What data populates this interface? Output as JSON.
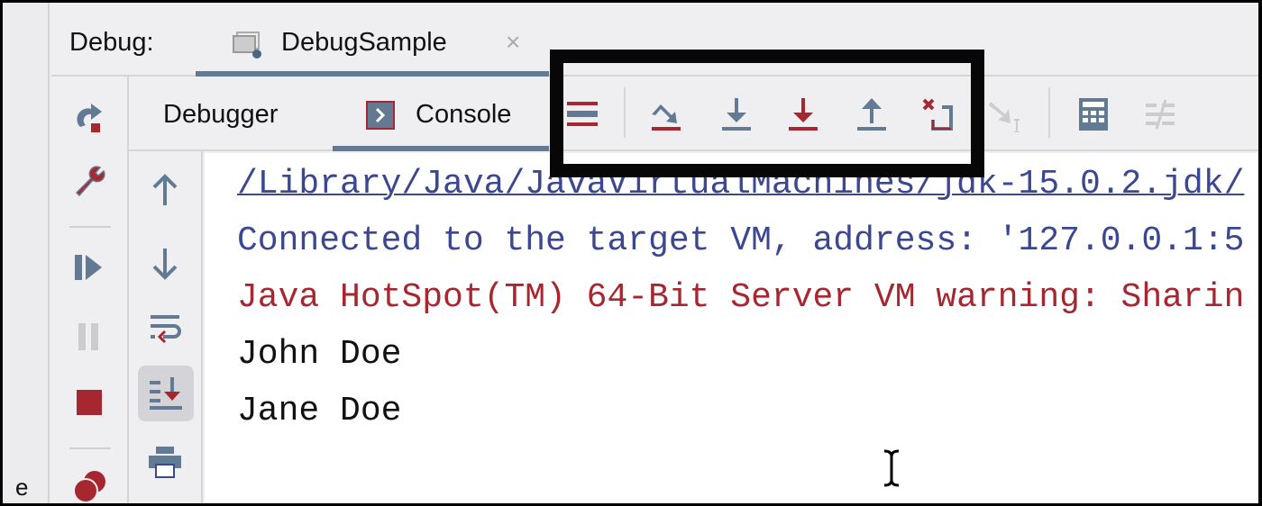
{
  "header": {
    "label": "Debug:",
    "tab_title": "DebugSample",
    "tab_close": "×"
  },
  "left_strip": {
    "fragment": "e"
  },
  "subtabs": {
    "debugger": "Debugger",
    "console": "Console"
  },
  "toolbar_icons": [
    "layout-menu-icon",
    "step-over-icon",
    "step-into-icon",
    "force-step-into-icon",
    "step-out-icon",
    "drop-frame-icon",
    "run-to-cursor-icon",
    "evaluate-expression-icon",
    "trace-icon"
  ],
  "console": {
    "lines": [
      {
        "text": "/Library/Java/JavaVirtualMachines/jdk-15.0.2.jdk/",
        "kind": "path"
      },
      {
        "text": "Connected to the target VM, address: '127.0.0.1:5",
        "kind": "info"
      },
      {
        "text": "Java HotSpot(TM) 64-Bit Server VM warning: Sharin",
        "kind": "warn"
      },
      {
        "text": "John Doe",
        "kind": "out"
      },
      {
        "text": "Jane Doe",
        "kind": "out"
      }
    ]
  },
  "colors": {
    "accent": "#627a94",
    "link": "#3b4790",
    "error": "#a6272f",
    "highlight_box": "#070707"
  }
}
